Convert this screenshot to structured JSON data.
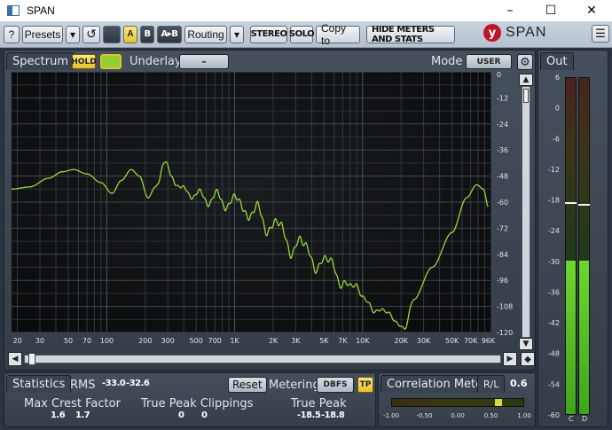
{
  "window": {
    "title": "SPAN",
    "minimize_glyph": "–",
    "maximize_glyph": "☐",
    "close_glyph": "✕"
  },
  "toolbar": {
    "help": "?",
    "presets": "Presets",
    "presets_arrow": "▾",
    "undo": "↺",
    "a": "A",
    "b": "B",
    "a_to_b": "A▸B",
    "routing": "Routing",
    "routing_arrow": "▾",
    "stereo": "STEREO",
    "solo": "SOLO",
    "copy_to": "Copy to",
    "hide_meters": "HIDE METERS AND STATS",
    "logo_mark": "y",
    "logo_text": "SPAN",
    "menu": "☰"
  },
  "spectrum": {
    "tab": "Spectrum",
    "hold": "HOLD",
    "underlay_label": "Underlay",
    "underlay_value": "–",
    "mode_label": "Mode",
    "mode_value": "USER",
    "gear": "⚙",
    "db_ticks": [
      "0",
      "-12",
      "-24",
      "-36",
      "-48",
      "-60",
      "-72",
      "-84",
      "-96",
      "-108",
      "-120"
    ],
    "freq_ticks": [
      "20",
      "30",
      "50",
      "70",
      "100",
      "200",
      "300",
      "500",
      "700",
      "1K",
      "2K",
      "3K",
      "5K",
      "7K",
      "10K",
      "20K",
      "30K",
      "50K",
      "70K",
      "96K"
    ],
    "curve_color": "#9cd43a",
    "scroll_up": "▲",
    "scroll_down": "▼",
    "scroll_left": "◀",
    "scroll_right": "▶",
    "scroll_reset": "◆"
  },
  "out": {
    "tab": "Out",
    "ticks": [
      "6",
      "0",
      "-6",
      "-12",
      "-18",
      "-24",
      "-30",
      "-36",
      "-42",
      "-48",
      "-54",
      "-60"
    ],
    "left_label": "C",
    "right_label": "D",
    "left_level_db": -30,
    "right_level_db": -30,
    "left_peak_db": -18.5,
    "right_peak_db": -18.8,
    "meter_color": "#4ec225"
  },
  "statistics": {
    "tab": "Statistics",
    "rms_label": "RMS",
    "rms_left": "-33.0",
    "rms_right": "-32.6",
    "reset": "Reset",
    "metering_label": "Metering",
    "metering_value": "DBFS",
    "tp": "TP",
    "crest_label": "Max Crest Factor",
    "crest_left": "1.6",
    "crest_right": "1.7",
    "clip_label": "True Peak Clippings",
    "clip_left": "0",
    "clip_right": "0",
    "tpeak_label": "True Peak",
    "tpeak_left": "-18.5",
    "tpeak_right": "-18.8"
  },
  "correlation": {
    "tab": "Correlation Meter",
    "mode": "R/L",
    "value": "0.6",
    "scale": [
      "-1.00",
      "-0.50",
      "0.00",
      "0.50",
      "1.00"
    ]
  }
}
